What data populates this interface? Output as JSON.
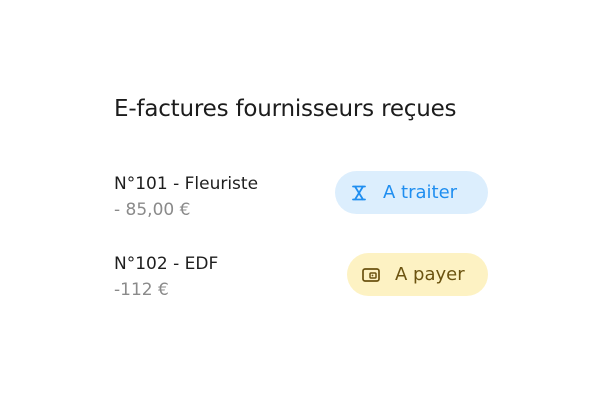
{
  "header": {
    "title": "E-factures fournisseurs reçues"
  },
  "invoices": [
    {
      "name": "N°101 - Fleuriste",
      "amount": "- 85,00 €",
      "status": {
        "label": "A traiter",
        "icon": "hourglass-icon",
        "color": "#1f8ef0",
        "background": "#dceefd"
      }
    },
    {
      "name": "N°102 - EDF",
      "amount": "-112 €",
      "status": {
        "label": "A payer",
        "icon": "wallet-icon",
        "color": "#6b5310",
        "background": "#fdf2c3"
      }
    }
  ]
}
